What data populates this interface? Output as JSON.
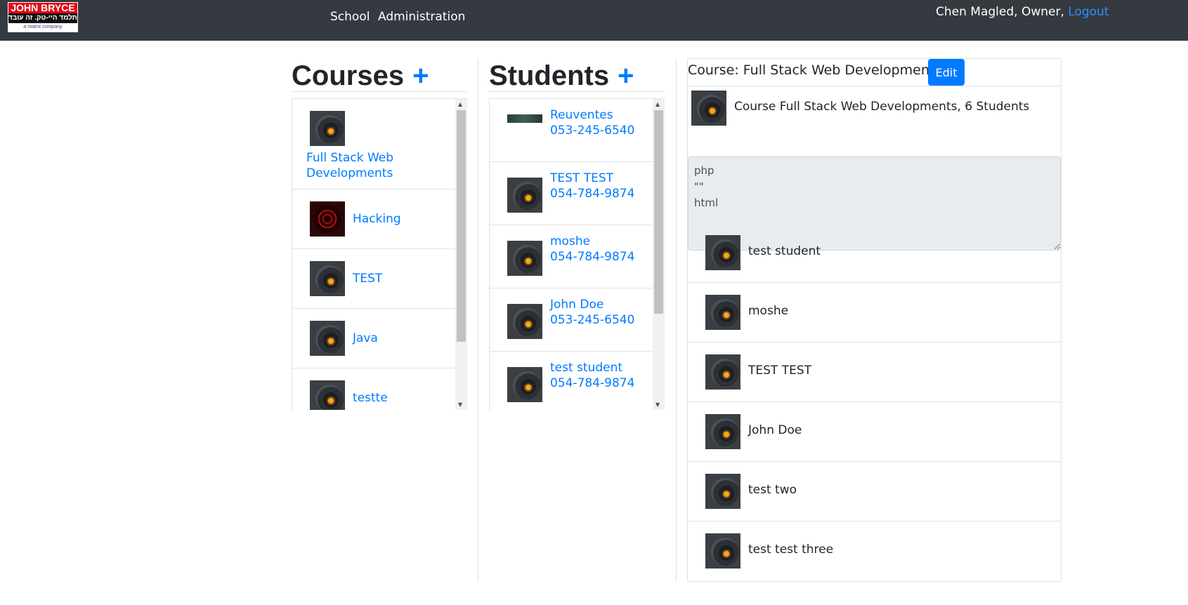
{
  "nav": {
    "logo": {
      "line1": "JOHN BRYCE",
      "line2": "תלמד היי-טק. זה עובד!",
      "line3": "a matrix company"
    },
    "links": [
      "School",
      "Administration"
    ],
    "user": {
      "text": "Chen Magled, Owner,",
      "logout": "Logout"
    }
  },
  "courses": {
    "title": "Courses",
    "add": "+",
    "items": [
      {
        "name": "Full Stack Web Developments",
        "icon": "course-thumbnail"
      },
      {
        "name": "Hacking",
        "icon": "hacking-thumbnail"
      },
      {
        "name": "TEST",
        "icon": "course-thumbnail"
      },
      {
        "name": "Java",
        "icon": "course-thumbnail"
      },
      {
        "name": "testte",
        "icon": "course-thumbnail"
      }
    ]
  },
  "students": {
    "title": "Students",
    "add": "+",
    "items": [
      {
        "name": "Reuventes",
        "phone": "053-245-6540"
      },
      {
        "name": "TEST TEST",
        "phone": "054-784-9874"
      },
      {
        "name": "moshe",
        "phone": "054-784-9874"
      },
      {
        "name": "John Doe",
        "phone": "053-245-6540"
      },
      {
        "name": "test student",
        "phone": "054-784-9874"
      }
    ]
  },
  "details": {
    "title": "Course: Full Stack Web Developments",
    "edit": "Edit",
    "summary": "Course Full Stack Web Developments, 6 Students",
    "description": "php\n\"\"\nhtml",
    "students": [
      "test student",
      "moshe",
      "TEST TEST",
      "John Doe",
      "test two",
      "test test three"
    ]
  },
  "colors": {
    "navbar": "#343a40",
    "link": "#007bff",
    "primary": "#007bff"
  }
}
